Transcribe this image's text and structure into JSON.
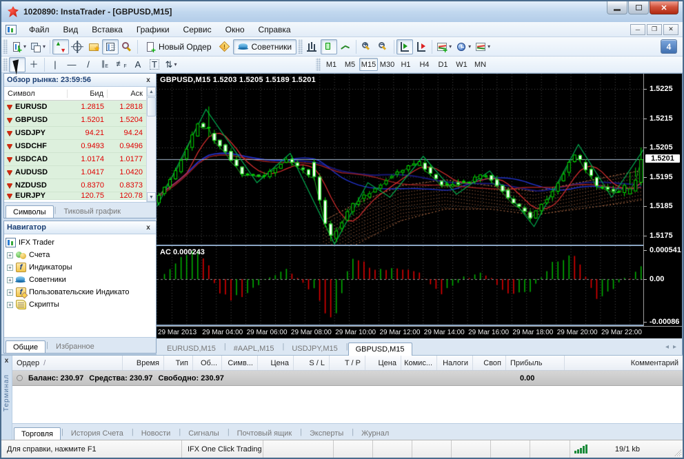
{
  "window": {
    "title": "1020890: InstaTrader - [GBPUSD,M15]"
  },
  "menu": {
    "items": [
      "Файл",
      "Вид",
      "Вставка",
      "Графики",
      "Сервис",
      "Окно",
      "Справка"
    ]
  },
  "toolbar": {
    "new_order_label": "Новый Ордер",
    "advisors_label": "Советники",
    "notification_count": "4",
    "timeframes": [
      "M1",
      "M5",
      "M15",
      "M30",
      "H1",
      "H4",
      "D1",
      "W1",
      "MN"
    ],
    "active_timeframe": "M15",
    "drawing_glyphs": {
      "vline": "|",
      "hline": "—",
      "trend": "/",
      "channel": "∥",
      "fibo": "≢",
      "text_a": "A",
      "text_t": "T",
      "arrows": "⇅",
      "cross": "＋"
    }
  },
  "market_watch": {
    "title": "Обзор рынка: 23:59:56",
    "columns": [
      "Символ",
      "Бид",
      "Аск"
    ],
    "rows": [
      {
        "symbol": "EURUSD",
        "bid": "1.2815",
        "ask": "1.2818"
      },
      {
        "symbol": "GBPUSD",
        "bid": "1.5201",
        "ask": "1.5204"
      },
      {
        "symbol": "USDJPY",
        "bid": "94.21",
        "ask": "94.24"
      },
      {
        "symbol": "USDCHF",
        "bid": "0.9493",
        "ask": "0.9496"
      },
      {
        "symbol": "USDCAD",
        "bid": "1.0174",
        "ask": "1.0177"
      },
      {
        "symbol": "AUDUSD",
        "bid": "1.0417",
        "ask": "1.0420"
      },
      {
        "symbol": "NZDUSD",
        "bid": "0.8370",
        "ask": "0.8373"
      },
      {
        "symbol": "EURJPY",
        "bid": "120.75",
        "ask": "120.78"
      }
    ],
    "tabs": [
      "Символы",
      "Тиковый график"
    ],
    "active_tab": "Символы"
  },
  "navigator": {
    "title": "Навигатор",
    "root": "IFX Trader",
    "items": [
      {
        "label": "Счета",
        "icon": "accounts"
      },
      {
        "label": "Индикаторы",
        "icon": "indicators"
      },
      {
        "label": "Советники",
        "icon": "advisors"
      },
      {
        "label": "Пользовательские Индикато",
        "icon": "custom-indicators"
      },
      {
        "label": "Скрипты",
        "icon": "scripts"
      }
    ],
    "tabs": [
      "Общие",
      "Избранное"
    ],
    "active_tab": "Общие"
  },
  "chart": {
    "header_line": "GBPUSD,M15  1.5203 1.5205 1.5189 1.5201",
    "price_ticks": [
      "1.5225",
      "1.5215",
      "1.5205",
      "1.5195",
      "1.5185",
      "1.5175"
    ],
    "current_price": "1.5201",
    "time_labels": [
      "29 Mar 2013",
      "29 Mar 04:00",
      "29 Mar 06:00",
      "29 Mar 08:00",
      "29 Mar 10:00",
      "29 Mar 12:00",
      "29 Mar 14:00",
      "29 Mar 16:00",
      "29 Mar 18:00",
      "29 Mar 20:00",
      "29 Mar 22:00"
    ],
    "tabs": [
      {
        "label": "EURUSD,M15",
        "active": false
      },
      {
        "label": "#AAPL,M15",
        "active": false
      },
      {
        "label": "USDJPY,M15",
        "active": false
      },
      {
        "label": "GBPUSD,M15",
        "active": true
      }
    ]
  },
  "ac_indicator": {
    "label": "AC 0.000243",
    "ticks": [
      "0.000541",
      "0.00",
      "-0.00086"
    ]
  },
  "chart_data": {
    "type": "candlestick",
    "symbol": "GBPUSD",
    "timeframe": "M15",
    "ohlc": {
      "open": 1.5203,
      "high": 1.5205,
      "low": 1.5189,
      "close": 1.5201
    },
    "price_axis": {
      "top": 1.5225,
      "step": 0.001,
      "ticks": [
        1.5225,
        1.5215,
        1.5205,
        1.5195,
        1.5185,
        1.5175
      ],
      "current": 1.5201
    },
    "hours_span": [
      2,
      24
    ],
    "hourly_anchors": [
      1.519,
      1.5188,
      1.5186,
      1.5197,
      1.5213,
      1.5206,
      1.5196,
      1.5195,
      1.5201,
      1.5196,
      1.5174,
      1.5186,
      1.5191,
      1.5197,
      1.52,
      1.5192,
      1.5193,
      1.5196,
      1.5188,
      1.5181,
      1.519,
      1.5203,
      1.5192,
      1.519,
      1.5201
    ],
    "zigzag": [
      [
        2,
        1.5185
      ],
      [
        4.2,
        1.5218
      ],
      [
        6.5,
        1.5193
      ],
      [
        8,
        1.5203
      ],
      [
        10,
        1.5172
      ],
      [
        11.5,
        1.5193
      ],
      [
        12.5,
        1.5188
      ],
      [
        14,
        1.5202
      ],
      [
        15.5,
        1.5189
      ],
      [
        17,
        1.5197
      ],
      [
        19,
        1.5178
      ],
      [
        21,
        1.5206
      ],
      [
        22.5,
        1.5188
      ],
      [
        24,
        1.5205
      ]
    ],
    "cloud": {
      "hours": [
        9.5,
        11,
        13,
        15,
        17,
        19,
        21,
        23,
        24.5
      ],
      "spanA": [
        1.518,
        1.5186,
        1.5192,
        1.5194,
        1.5192,
        1.519,
        1.5193,
        1.5196,
        1.5198
      ],
      "spanB": [
        1.5168,
        1.5172,
        1.518,
        1.5184,
        1.5184,
        1.5182,
        1.5184,
        1.5186,
        1.5188
      ]
    },
    "bid_line": 1.5201,
    "ac": {
      "last_value": 0.000243,
      "axis": {
        "max": 0.000541,
        "zero": 0.0,
        "min": -0.00086
      },
      "momentum_k": 0.35
    }
  },
  "terminal": {
    "columns": [
      "Ордер",
      "Время",
      "Тип",
      "Об...",
      "Симв...",
      "Цена",
      "S / L",
      "T / P",
      "Цена",
      "Комис...",
      "Налоги",
      "Своп",
      "Прибыль",
      "Комментарий"
    ],
    "sort_glyph": "/",
    "balance_items": [
      "Баланс: 230.97",
      "Средства: 230.97",
      "Свободно: 230.97"
    ],
    "profit_value": "0.00",
    "tabs": [
      "Торговля",
      "История Счета",
      "Новости",
      "Сигналы",
      "Почтовый ящик",
      "Эксперты",
      "Журнал"
    ],
    "active_tab": "Торговля",
    "side_label": "Терминал"
  },
  "status_bar": {
    "help_text": "Для справки, нажмите F1",
    "one_click": "IFX One Click Trading",
    "traffic": "19/1 kb"
  }
}
